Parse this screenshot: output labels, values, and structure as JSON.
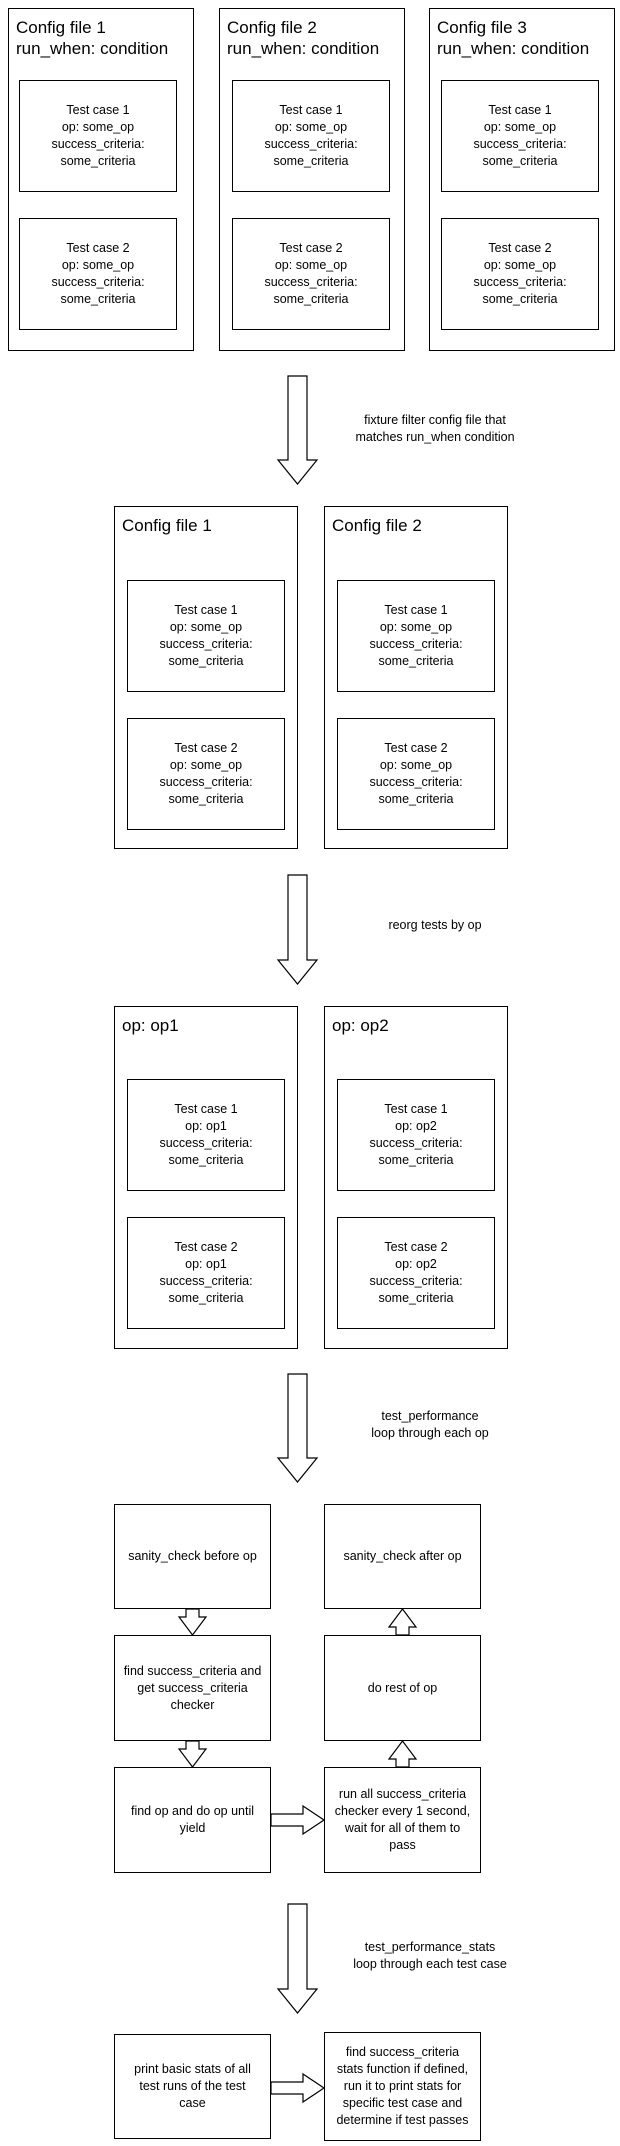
{
  "stage1": {
    "configs": [
      {
        "title": "Config file 1\nrun_when: condition",
        "tests": [
          "Test case 1\nop: some_op\nsuccess_criteria:\nsome_criteria",
          "Test case 2\nop: some_op\nsuccess_criteria:\nsome_criteria"
        ]
      },
      {
        "title": "Config file 2\nrun_when: condition",
        "tests": [
          "Test case 1\nop: some_op\nsuccess_criteria:\nsome_criteria",
          "Test case 2\nop: some_op\nsuccess_criteria:\nsome_criteria"
        ]
      },
      {
        "title": "Config file 3\nrun_when: condition",
        "tests": [
          "Test case 1\nop: some_op\nsuccess_criteria:\nsome_criteria",
          "Test case 2\nop: some_op\nsuccess_criteria:\nsome_criteria"
        ]
      }
    ]
  },
  "arrow1_label": "fixture filter config file that\nmatches run_when condition",
  "stage2": {
    "configs": [
      {
        "title": "Config file 1",
        "tests": [
          "Test case 1\nop: some_op\nsuccess_criteria:\nsome_criteria",
          "Test case 2\nop: some_op\nsuccess_criteria:\nsome_criteria"
        ]
      },
      {
        "title": "Config file 2",
        "tests": [
          "Test case 1\nop: some_op\nsuccess_criteria:\nsome_criteria",
          "Test case 2\nop: some_op\nsuccess_criteria:\nsome_criteria"
        ]
      }
    ]
  },
  "arrow2_label": "reorg tests by op",
  "stage3": {
    "groups": [
      {
        "title": "op: op1",
        "tests": [
          "Test case 1\nop: op1\nsuccess_criteria:\nsome_criteria",
          "Test case 2\nop: op1\nsuccess_criteria:\nsome_criteria"
        ]
      },
      {
        "title": "op: op2",
        "tests": [
          "Test case 1\nop: op2\nsuccess_criteria:\nsome_criteria",
          "Test case 2\nop: op2\nsuccess_criteria:\nsome_criteria"
        ]
      }
    ]
  },
  "arrow3_label": "test_performance\nloop through each op",
  "stage4": {
    "sanity_before": "sanity_check before op",
    "find_criteria": "find success_criteria and\nget success_criteria\nchecker",
    "find_op": "find op and do op until\nyield",
    "sanity_after": "sanity_check after op",
    "rest_of_op": "do rest of op",
    "run_checkers": "run all success_criteria\nchecker every 1 second,\nwait for all of them to\npass"
  },
  "arrow4_label": "test_performance_stats\nloop through each test case",
  "stage5": {
    "print_stats": "print basic stats of all\ntest runs of the test\ncase",
    "stats_function": "find success_criteria\nstats function if defined,\nrun it to print stats for\nspecific test case and\ndetermine if test passes"
  }
}
